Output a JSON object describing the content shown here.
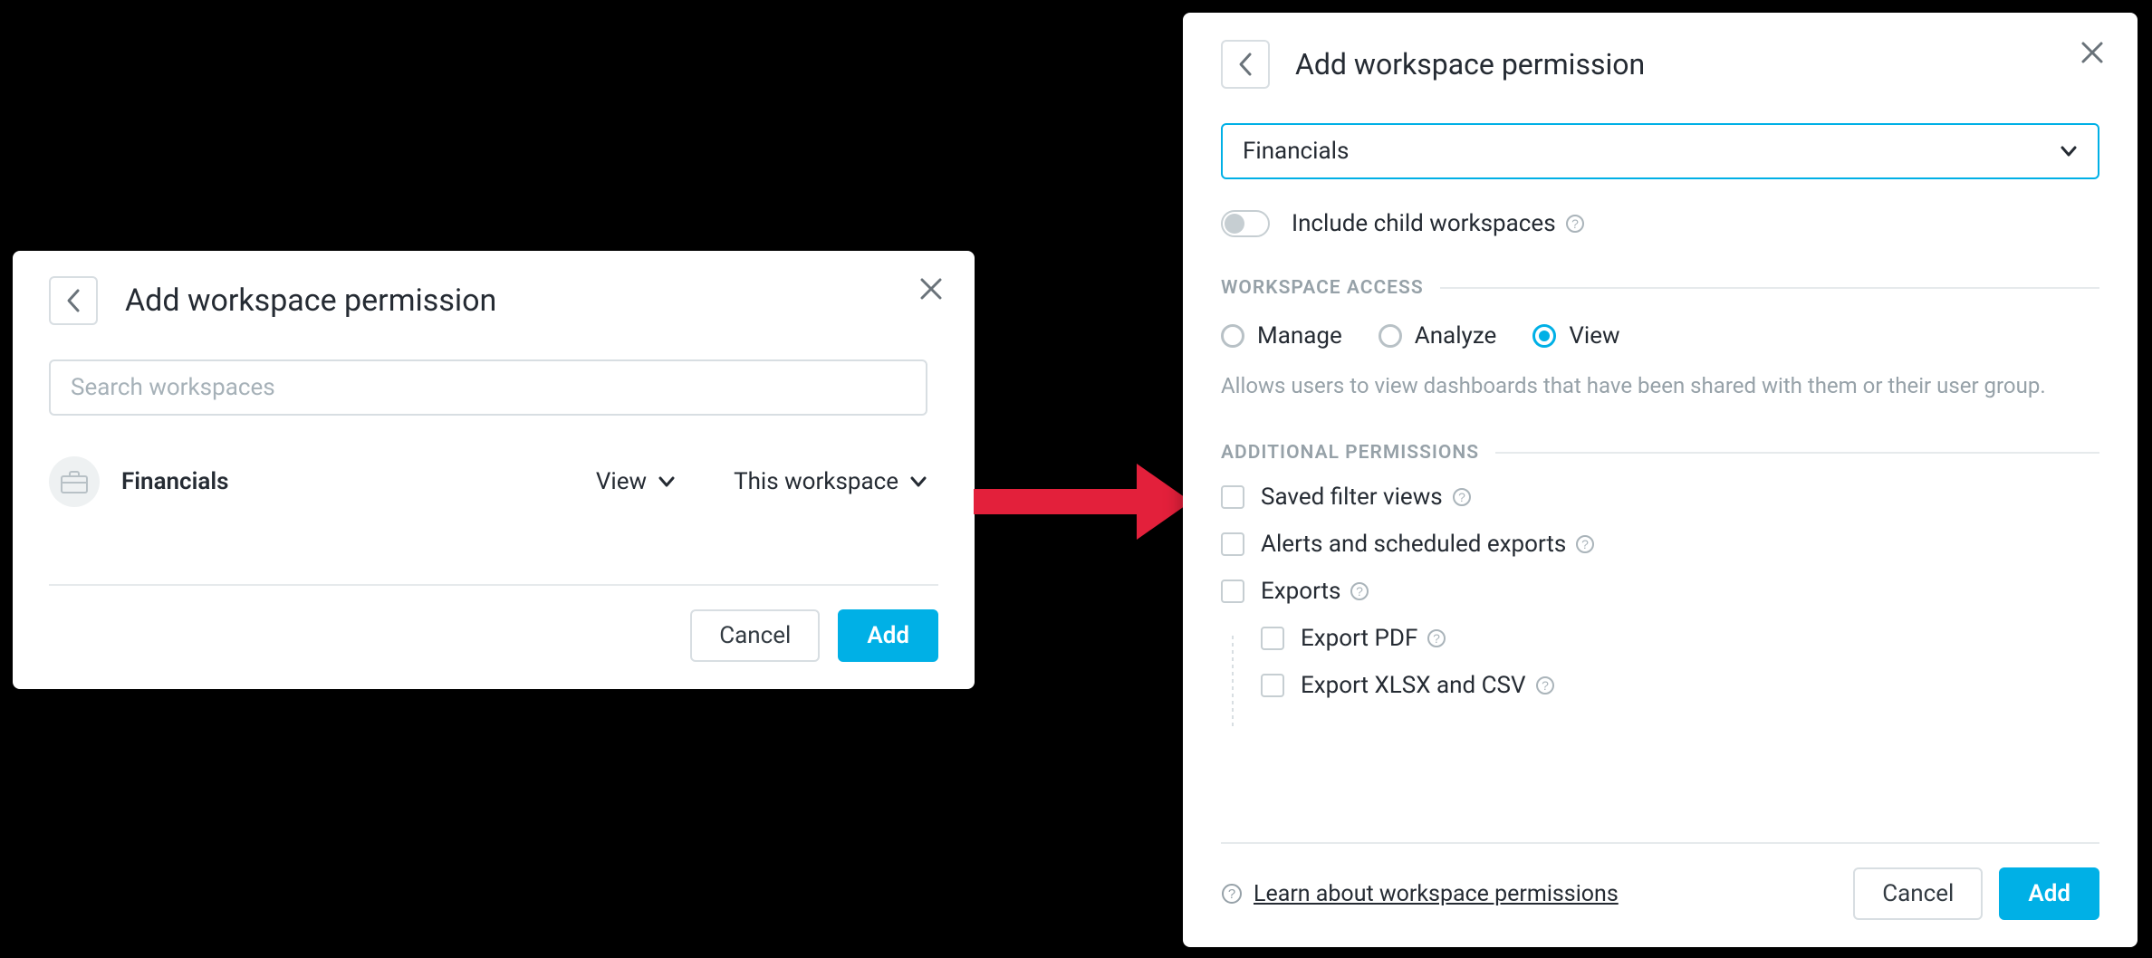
{
  "colors": {
    "accent": "#00b0e6",
    "arrow": "#e3203b"
  },
  "left_modal": {
    "title": "Add workspace permission",
    "search_placeholder": "Search workspaces",
    "workspace": {
      "name": "Financials",
      "access_dropdown": "View",
      "scope_dropdown": "This workspace"
    },
    "cancel_label": "Cancel",
    "add_label": "Add"
  },
  "right_modal": {
    "title": "Add workspace permission",
    "selected_workspace": "Financials",
    "include_children_label": "Include child workspaces",
    "section_access": "WORKSPACE ACCESS",
    "access_options": {
      "manage": "Manage",
      "analyze": "Analyze",
      "view": "View"
    },
    "access_selected": "view",
    "access_description": "Allows users to view dashboards that have been shared with them or their user group.",
    "section_additional": "ADDITIONAL PERMISSIONS",
    "permissions": {
      "saved_filter_views": "Saved filter views",
      "alerts_exports": "Alerts and scheduled exports",
      "exports": "Exports",
      "export_pdf": "Export PDF",
      "export_xlsx_csv": "Export XLSX and CSV"
    },
    "learn_link": "Learn about workspace permissions",
    "cancel_label": "Cancel",
    "add_label": "Add"
  }
}
